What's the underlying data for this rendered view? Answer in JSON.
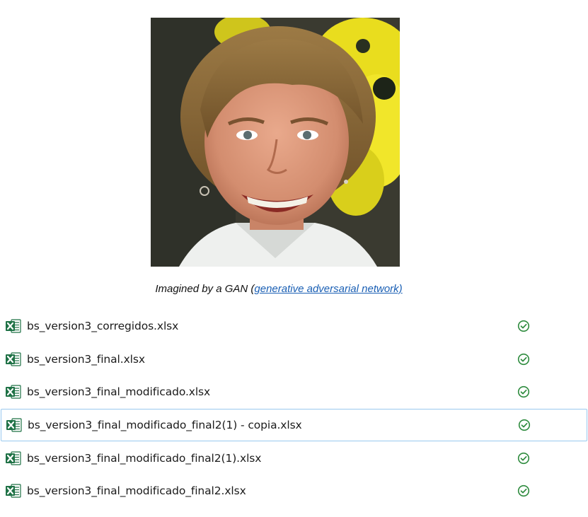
{
  "caption": {
    "prefix": "Imagined by a GAN (",
    "link_text": "generative adversarial network)"
  },
  "portrait": {
    "description_icon": "smiling-woman-portrait",
    "background_colors": [
      "#3b3d33",
      "#f2e81c"
    ]
  },
  "files": [
    {
      "name": "bs_version3_corregidos.xlsx",
      "icon": "excel-file-icon",
      "status": "synced-check-icon",
      "selected": false
    },
    {
      "name": "bs_version3_final.xlsx",
      "icon": "excel-file-icon",
      "status": "synced-check-icon",
      "selected": false
    },
    {
      "name": "bs_version3_final_modificado.xlsx",
      "icon": "excel-file-icon",
      "status": "synced-check-icon",
      "selected": false
    },
    {
      "name": "bs_version3_final_modificado_final2(1) - copia.xlsx",
      "icon": "excel-file-icon",
      "status": "synced-check-icon",
      "selected": true
    },
    {
      "name": "bs_version3_final_modificado_final2(1).xlsx",
      "icon": "excel-file-icon",
      "status": "synced-check-icon",
      "selected": false
    },
    {
      "name": "bs_version3_final_modificado_final2.xlsx",
      "icon": "excel-file-icon",
      "status": "synced-check-icon",
      "selected": false
    }
  ],
  "colors": {
    "excel_green": "#1e7145",
    "status_green": "#2e8b3e",
    "link_blue": "#1a5fb4",
    "selection_border": "#99c9ef"
  }
}
